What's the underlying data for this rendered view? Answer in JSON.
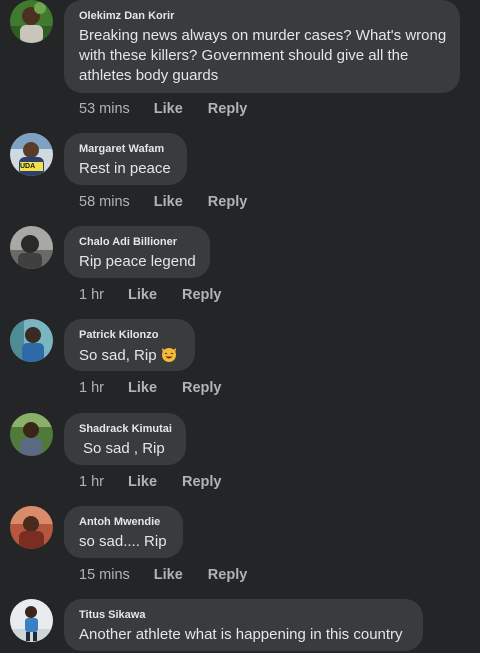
{
  "actions": {
    "like_label": "Like",
    "reply_label": "Reply"
  },
  "comments": [
    {
      "author": "Olekimz Dan Korir",
      "text_lines": [
        "Breaking news always on murder cases? What's wrong",
        "with these killers? Government should give all the",
        "athletes body guards"
      ],
      "time": "53 mins"
    },
    {
      "author": "Margaret Wafam",
      "text": "Rest in peace",
      "time": "58 mins",
      "avatar_badge": "UDA"
    },
    {
      "author": "Chalo Adi Billioner",
      "text": "Rip peace legend",
      "time": "1 hr"
    },
    {
      "author": "Patrick Kilonzo",
      "text": "So sad, Rip",
      "emoji": "smiling-cat-icon",
      "time": "1 hr"
    },
    {
      "author": "Shadrack Kimutai",
      "text": "So sad , Rip",
      "time": "1 hr"
    },
    {
      "author": "Antoh Mwendie",
      "text": "so sad.... Rip",
      "time": "15 mins"
    },
    {
      "author": "Titus Sikawa",
      "text": "Another athlete what is happening in this country"
    }
  ],
  "colors": {
    "background": "#242526",
    "bubble": "#3a3b3c",
    "primary_text": "#e4e6eb",
    "secondary_text": "#b0b3b8"
  }
}
